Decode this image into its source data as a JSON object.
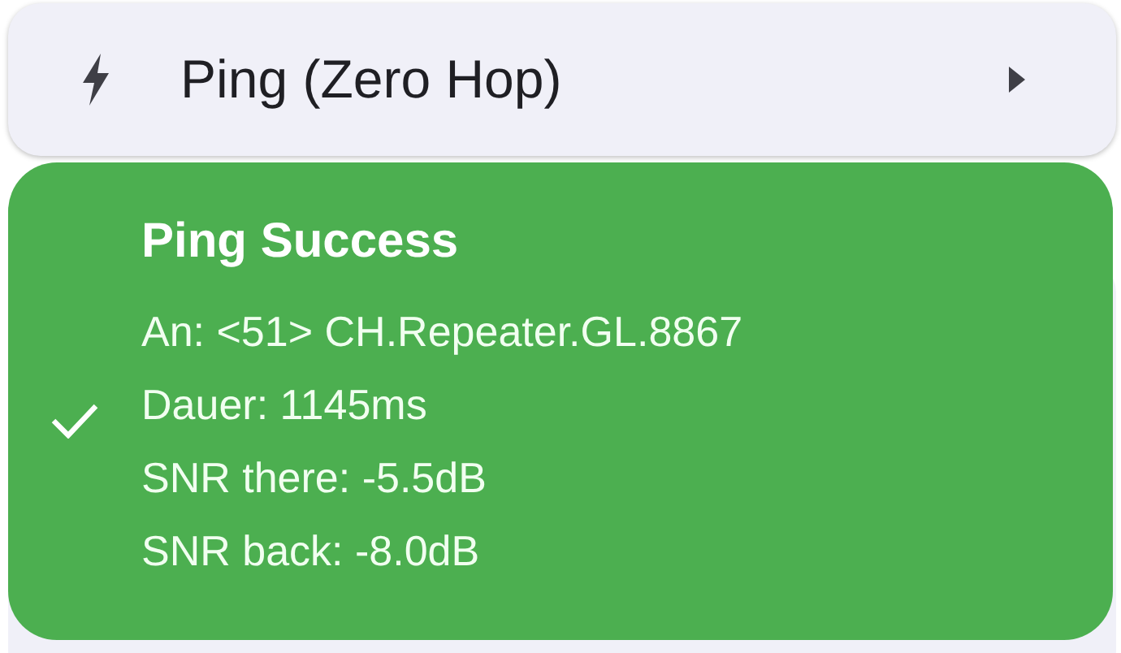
{
  "menu_item": {
    "label": "Ping (Zero Hop)"
  },
  "toast": {
    "title": "Ping Success",
    "checked": true,
    "lines": [
      "An: <51> CH.Repeater.GL.8867",
      "Dauer: 1145ms",
      "SNR there: -5.5dB",
      "SNR back: -8.0dB"
    ]
  }
}
